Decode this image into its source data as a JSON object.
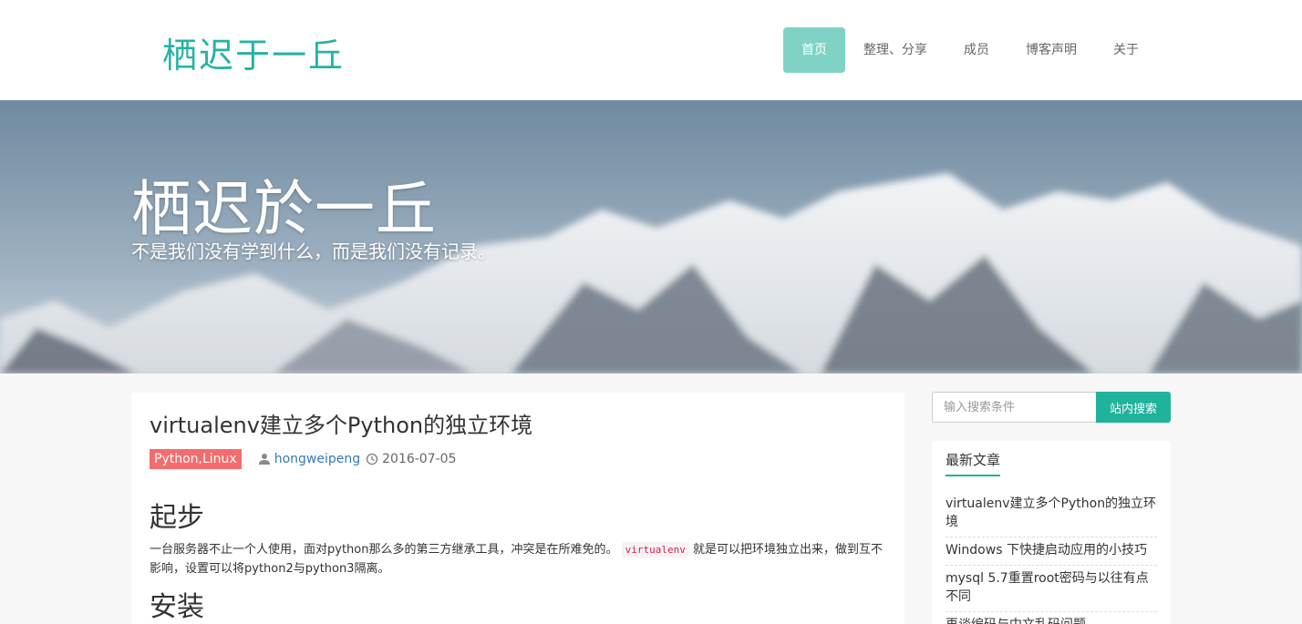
{
  "site": {
    "logo": "栖迟于一丘"
  },
  "nav": {
    "items": [
      {
        "label": "首页",
        "active": true
      },
      {
        "label": "整理、分享",
        "active": false
      },
      {
        "label": "成员",
        "active": false
      },
      {
        "label": "博客声明",
        "active": false
      },
      {
        "label": "关于",
        "active": false
      }
    ]
  },
  "hero": {
    "title": "栖迟於一丘",
    "subtitle": "不是我们没有学到什么，而是我们没有记录。"
  },
  "article": {
    "title": "virtualenv建立多个Python的独立环境",
    "tag": "Python,Linux",
    "author": "hongweipeng",
    "date": "2016-07-05",
    "section1": "起步",
    "para_before": "一台服务器不止一个人使用，面对python那么多的第三方继承工具，冲突是在所难免的。",
    "code": "virtualenv",
    "para_after": "就是可以把环境独立出来，做到互不影响，设置可以将python2与python3隔离。",
    "section2": "安装"
  },
  "search": {
    "placeholder": "输入搜索条件",
    "button": "站内搜索"
  },
  "recent": {
    "heading": "最新文章",
    "items": [
      "virtualenv建立多个Python的独立环境",
      "Windows 下快捷启动应用的小技巧",
      "mysql 5.7重置root密码与以往有点不同",
      "再谈编码与中文乱码问题"
    ]
  },
  "colors": {
    "accent": "#26b3a2",
    "nav_active": "#80d3c4",
    "tag": "#f56c6c",
    "link": "#337ab7"
  }
}
